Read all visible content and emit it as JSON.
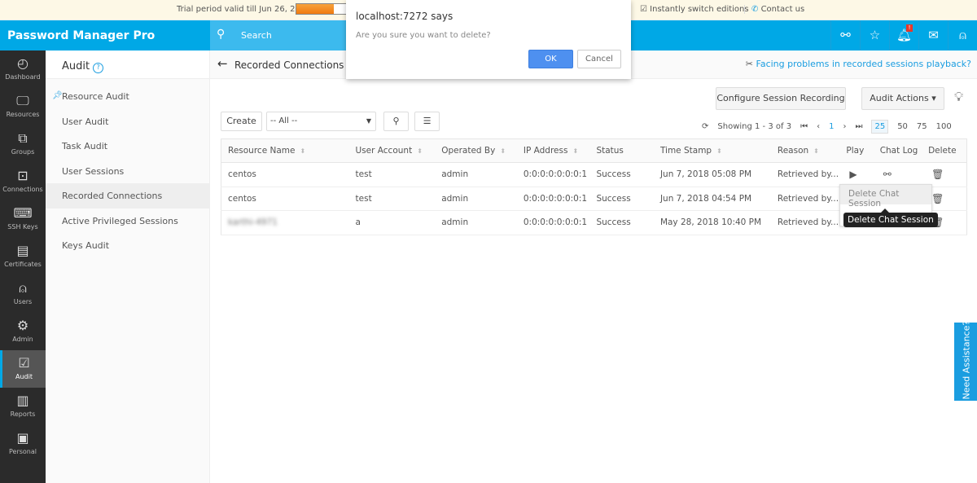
{
  "trial": {
    "text": "Trial period valid till Jun 26, 2018",
    "progress": 0.68,
    "switch": "Instantly switch editions",
    "contact": "Contact us"
  },
  "header": {
    "logo": "Password Manager Pro",
    "search": "Search",
    "badge": "!"
  },
  "nav": [
    {
      "label": "Dashboard",
      "icon": "◴"
    },
    {
      "label": "Resources",
      "icon": "🖵"
    },
    {
      "label": "Groups",
      "icon": "⧉"
    },
    {
      "label": "Connections",
      "icon": "⊡"
    },
    {
      "label": "SSH Keys",
      "icon": "⌨"
    },
    {
      "label": "Certificates",
      "icon": "▤"
    },
    {
      "label": "Users",
      "icon": "⍝"
    },
    {
      "label": "Admin",
      "icon": "⚙"
    },
    {
      "label": "Audit",
      "icon": "☑"
    },
    {
      "label": "Reports",
      "icon": "▥"
    },
    {
      "label": "Personal",
      "icon": "▣"
    }
  ],
  "sub": {
    "title": "Audit",
    "help": "?",
    "items": [
      "Resource Audit",
      "User Audit",
      "Task Audit",
      "User Sessions",
      "Recorded Connections",
      "Active Privileged Sessions",
      "Keys Audit"
    ]
  },
  "page": {
    "title": "Recorded Connections",
    "help_link": "Facing problems in recorded sessions playback?",
    "configure": "Configure Session Recording",
    "audit_actions": "Audit Actions",
    "create": "Create",
    "filter": "-- All --"
  },
  "pager": {
    "showing": "Showing 1 - 3 of 3",
    "page": "1",
    "sizes": [
      "25",
      "50",
      "75",
      "100"
    ]
  },
  "table": {
    "columns": [
      "Resource Name",
      "User Account",
      "Operated By",
      "IP Address",
      "Status",
      "Time Stamp",
      "Reason",
      "Play",
      "Chat Log",
      "Delete"
    ],
    "rows": [
      [
        "centos",
        "test",
        "admin",
        "0:0:0:0:0:0:0:1",
        "Success",
        "Jun 7, 2018 05:08 PM",
        "Retrieved by..."
      ],
      [
        "centos",
        "test",
        "admin",
        "0:0:0:0:0:0:0:1",
        "Success",
        "Jun 7, 2018 04:54 PM",
        "Retrieved by..."
      ],
      [
        "karthi-4971",
        "a",
        "admin",
        "0:0:0:0:0:0:0:1",
        "Success",
        "May 28, 2018 10:40 PM",
        "Retrieved by..."
      ]
    ]
  },
  "menu": {
    "item": "Delete Chat Session",
    "tooltip": "Delete Chat Session"
  },
  "dialog": {
    "title": "localhost:7272 says",
    "message": "Are you sure you want to delete?",
    "ok": "OK",
    "cancel": "Cancel"
  },
  "assist": "Need Assistance?"
}
